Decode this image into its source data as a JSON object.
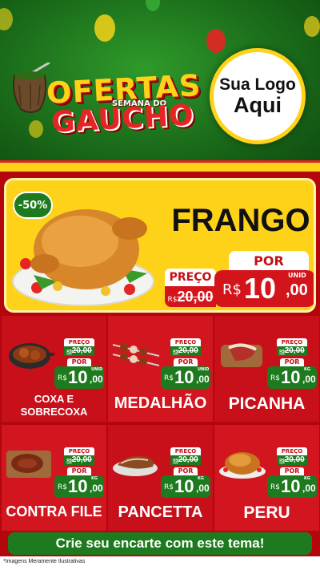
{
  "header": {
    "title_top": "OFERTAS",
    "title_sub": "SEMANA DO",
    "title_bottom": "GAUCHO",
    "logo_line1": "Sua Logo",
    "logo_line2": "Aqui"
  },
  "hero": {
    "discount": "-50%",
    "name": "FRANGO",
    "preco_label": "PREÇO",
    "old_currency": "R$",
    "old_price": "20,00",
    "por_label": "POR",
    "currency": "R$",
    "price_int": "10",
    "price_dec": ",00",
    "unit": "UNID"
  },
  "products": [
    {
      "name": "COXA E SOBRECOXA",
      "preco_label": "PREÇO",
      "old_currency": "R$",
      "old_price": "20,00",
      "por_label": "POR",
      "currency": "R$",
      "price_int": "10",
      "price_dec": ",00",
      "unit": "UNID"
    },
    {
      "name": "MEDALHÃO",
      "preco_label": "PREÇO",
      "old_currency": "R$",
      "old_price": "20,00",
      "por_label": "POR",
      "currency": "R$",
      "price_int": "10",
      "price_dec": ",00",
      "unit": "UNID"
    },
    {
      "name": "PICANHA",
      "preco_label": "PREÇO",
      "old_currency": "R$",
      "old_price": "20,00",
      "por_label": "POR",
      "currency": "R$",
      "price_int": "10",
      "price_dec": ",00",
      "unit": "KG"
    },
    {
      "name": "CONTRA FILE",
      "preco_label": "PREÇO",
      "old_currency": "R$",
      "old_price": "20,00",
      "por_label": "POR",
      "currency": "R$",
      "price_int": "10",
      "price_dec": ",00",
      "unit": "KG"
    },
    {
      "name": "PANCETTA",
      "preco_label": "PREÇO",
      "old_currency": "R$",
      "old_price": "20,00",
      "por_label": "POR",
      "currency": "R$",
      "price_int": "10",
      "price_dec": ",00",
      "unit": "KG"
    },
    {
      "name": "PERU",
      "preco_label": "PREÇO",
      "old_currency": "R$",
      "old_price": "20,00",
      "por_label": "POR",
      "currency": "R$",
      "price_int": "10",
      "price_dec": ",00",
      "unit": "KG"
    }
  ],
  "cta": "Crie seu encarte com este tema!",
  "disclaimer": "*Imagens Meramente Ilustrativas",
  "colors": {
    "green": "#1e7a1e",
    "red": "#c8101a",
    "yellow": "#ffd21a",
    "white": "#ffffff"
  }
}
